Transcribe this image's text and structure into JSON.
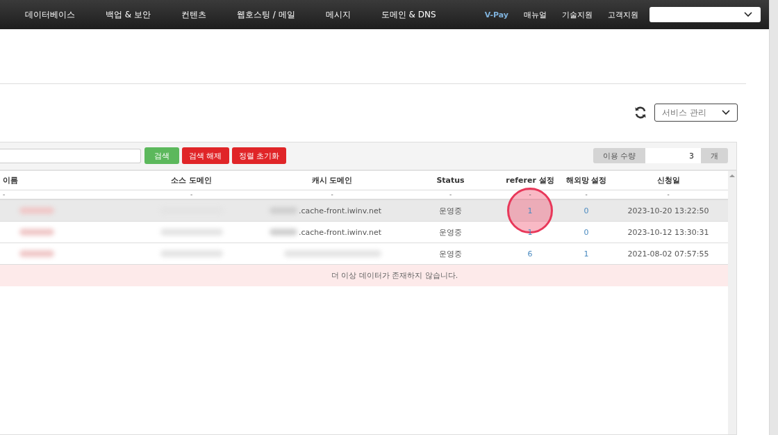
{
  "nav": {
    "items": [
      {
        "label": "데이터베이스"
      },
      {
        "label": "백업 & 보안"
      },
      {
        "label": "컨텐츠"
      },
      {
        "label": "웹호스팅 / 메일"
      },
      {
        "label": "메시지"
      },
      {
        "label": "도메인 & DNS"
      }
    ],
    "links": [
      {
        "label": "V-Pay",
        "kind": "accent"
      },
      {
        "label": "매뉴얼",
        "kind": "plain"
      },
      {
        "label": "기술지원",
        "kind": "plain"
      },
      {
        "label": "고객지원",
        "kind": "plain"
      }
    ]
  },
  "service_select": {
    "value": "서비스 관리"
  },
  "toolbar": {
    "buttons": [
      {
        "label": "검색",
        "kind": "primary"
      },
      {
        "label": "검색 해제",
        "kind": "danger"
      },
      {
        "label": "정렬 초기화",
        "kind": "danger"
      }
    ],
    "usage": {
      "label": "이용 수량",
      "value": "3",
      "unit": "개"
    }
  },
  "table": {
    "columns": [
      "이름",
      "소스 도메인",
      "캐시 도메인",
      "Status",
      "referer 설정",
      "해외망 설정",
      "신청일"
    ],
    "filter_row": [
      "-",
      "-",
      "-",
      "-",
      "-",
      "-",
      "-"
    ],
    "rows": [
      {
        "selected": true,
        "cache_domain": ".cache-front.iwinv.net",
        "status": "운영중",
        "referer": "1",
        "overseas": "0",
        "date": "2023-10-20 13:22:50",
        "click_marker": true
      },
      {
        "selected": false,
        "cache_domain": ".cache-front.iwinv.net",
        "status": "운영중",
        "referer": "1",
        "overseas": "0",
        "date": "2023-10-12 13:30:31",
        "click_marker": false
      },
      {
        "selected": false,
        "status": "운영중",
        "referer": "6",
        "overseas": "1",
        "date": "2021-08-02 07:57:55",
        "click_marker": false
      }
    ],
    "empty_message": "더 이상 데이터가 존재하지 않습니다."
  }
}
